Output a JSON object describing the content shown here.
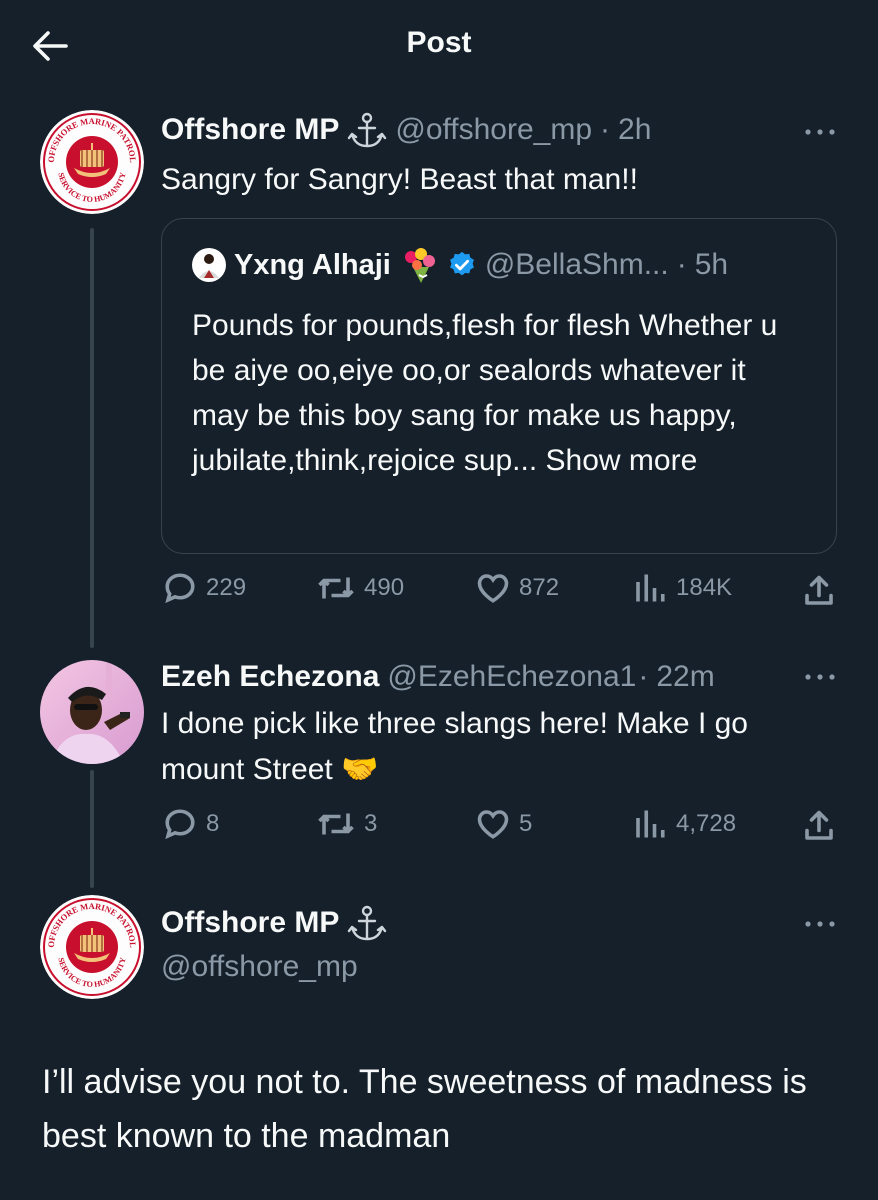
{
  "header": {
    "title": "Post"
  },
  "tweets": [
    {
      "name": "Offshore MP",
      "handle": "@offshore_mp",
      "time": "2h",
      "text": "Sangry for Sangry! Beast that man!!",
      "quote": {
        "name": "Yxng Alhaji",
        "handle": "@BellaShm...",
        "time": "5h",
        "text": "Pounds for pounds,flesh for flesh Whether u be aiye oo,eiye oo,or sealords whatever it may be this boy sang for make us happy, jubilate,think,rejoice sup...",
        "show_more": "Show more"
      },
      "stats": {
        "replies": "229",
        "reposts": "490",
        "likes": "872",
        "views": "184K"
      }
    },
    {
      "name": "Ezeh Echezona",
      "handle": "@EzehEchezona1",
      "time": "22m",
      "text": "I done pick like three slangs here! Make I go mount Street 🤝",
      "stats": {
        "replies": "8",
        "reposts": "3",
        "likes": "5",
        "views": "4,728"
      }
    },
    {
      "name": "Offshore MP",
      "handle": "@offshore_mp",
      "text": "I’ll advise you not to. The sweetness of madness is best known to the madman"
    }
  ],
  "logo": {
    "top_text": "OFFSHORE MARINE PATROL",
    "bottom_text": "SERVICE TO HUMANITY"
  },
  "colors": {
    "background": "#15202b",
    "muted": "#8b98a5",
    "verified": "#1d9bf0",
    "logo_red": "#c8102e"
  }
}
